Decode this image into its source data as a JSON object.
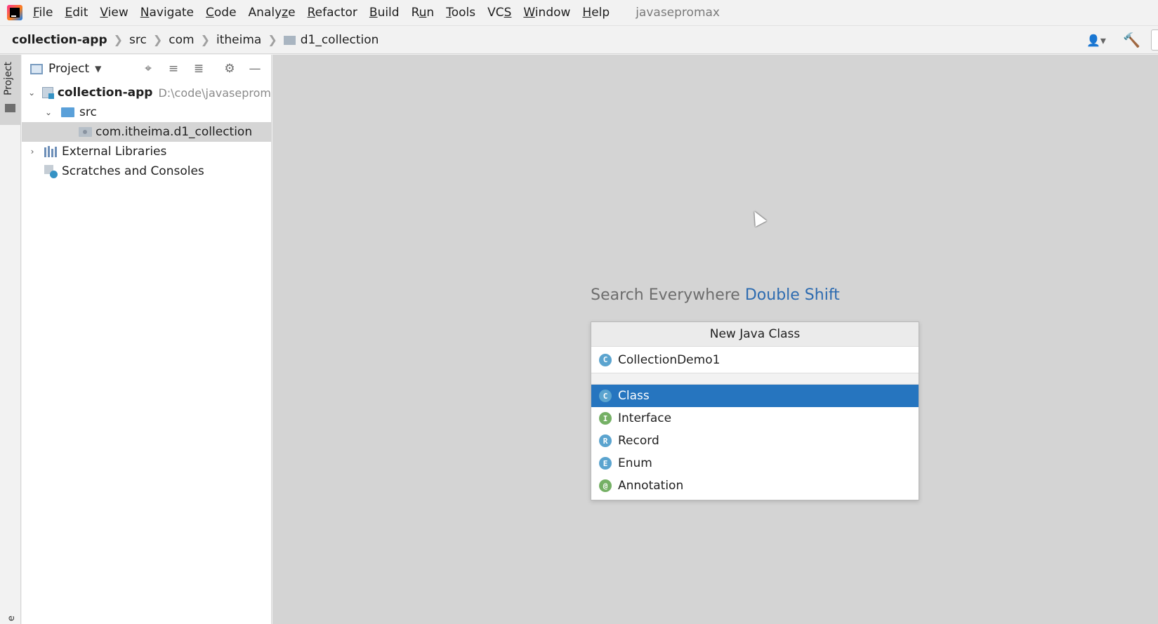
{
  "menubar": {
    "items": [
      {
        "mnemonic": "F",
        "rest": "ile"
      },
      {
        "mnemonic": "E",
        "rest": "dit"
      },
      {
        "mnemonic": "V",
        "rest": "iew"
      },
      {
        "mnemonic": "N",
        "rest": "avigate"
      },
      {
        "mnemonic": "C",
        "rest": "ode"
      },
      {
        "pre": "Analy",
        "mnemonic": "z",
        "rest": "e"
      },
      {
        "mnemonic": "R",
        "rest": "efactor"
      },
      {
        "mnemonic": "B",
        "rest": "uild"
      },
      {
        "pre": "R",
        "mnemonic": "u",
        "rest": "n"
      },
      {
        "mnemonic": "T",
        "rest": "ools"
      },
      {
        "pre": "VC",
        "mnemonic": "S",
        "rest": ""
      },
      {
        "mnemonic": "W",
        "rest": "indow"
      },
      {
        "mnemonic": "H",
        "rest": "elp"
      }
    ],
    "project_title": "javasepromax"
  },
  "breadcrumb": {
    "items": [
      "collection-app",
      "src",
      "com",
      "itheima",
      "d1_collection"
    ]
  },
  "tool_stripe": {
    "project_tab": "Project",
    "bottom_label": "e"
  },
  "project_panel": {
    "title": "Project",
    "tree": {
      "root_label": "collection-app",
      "root_path": "D:\\code\\javaseprom",
      "src_label": "src",
      "package_label": "com.itheima.d1_collection",
      "external_libraries": "External Libraries",
      "scratches": "Scratches and Consoles"
    }
  },
  "editor": {
    "hint_text": "Search Everywhere",
    "hint_shortcut": "Double Shift"
  },
  "new_class_popup": {
    "title": "New Java Class",
    "input_value": "CollectionDemo1",
    "kinds": [
      {
        "letter": "C",
        "label": "Class",
        "selected": true
      },
      {
        "letter": "I",
        "label": "Interface",
        "selected": false
      },
      {
        "letter": "R",
        "label": "Record",
        "selected": false
      },
      {
        "letter": "E",
        "label": "Enum",
        "selected": false
      },
      {
        "letter": "@",
        "label": "Annotation",
        "selected": false
      }
    ]
  },
  "colors": {
    "selection": "#2675bf",
    "editor_bg": "#d4d4d4",
    "shortcut_link": "#2d6bb0"
  }
}
